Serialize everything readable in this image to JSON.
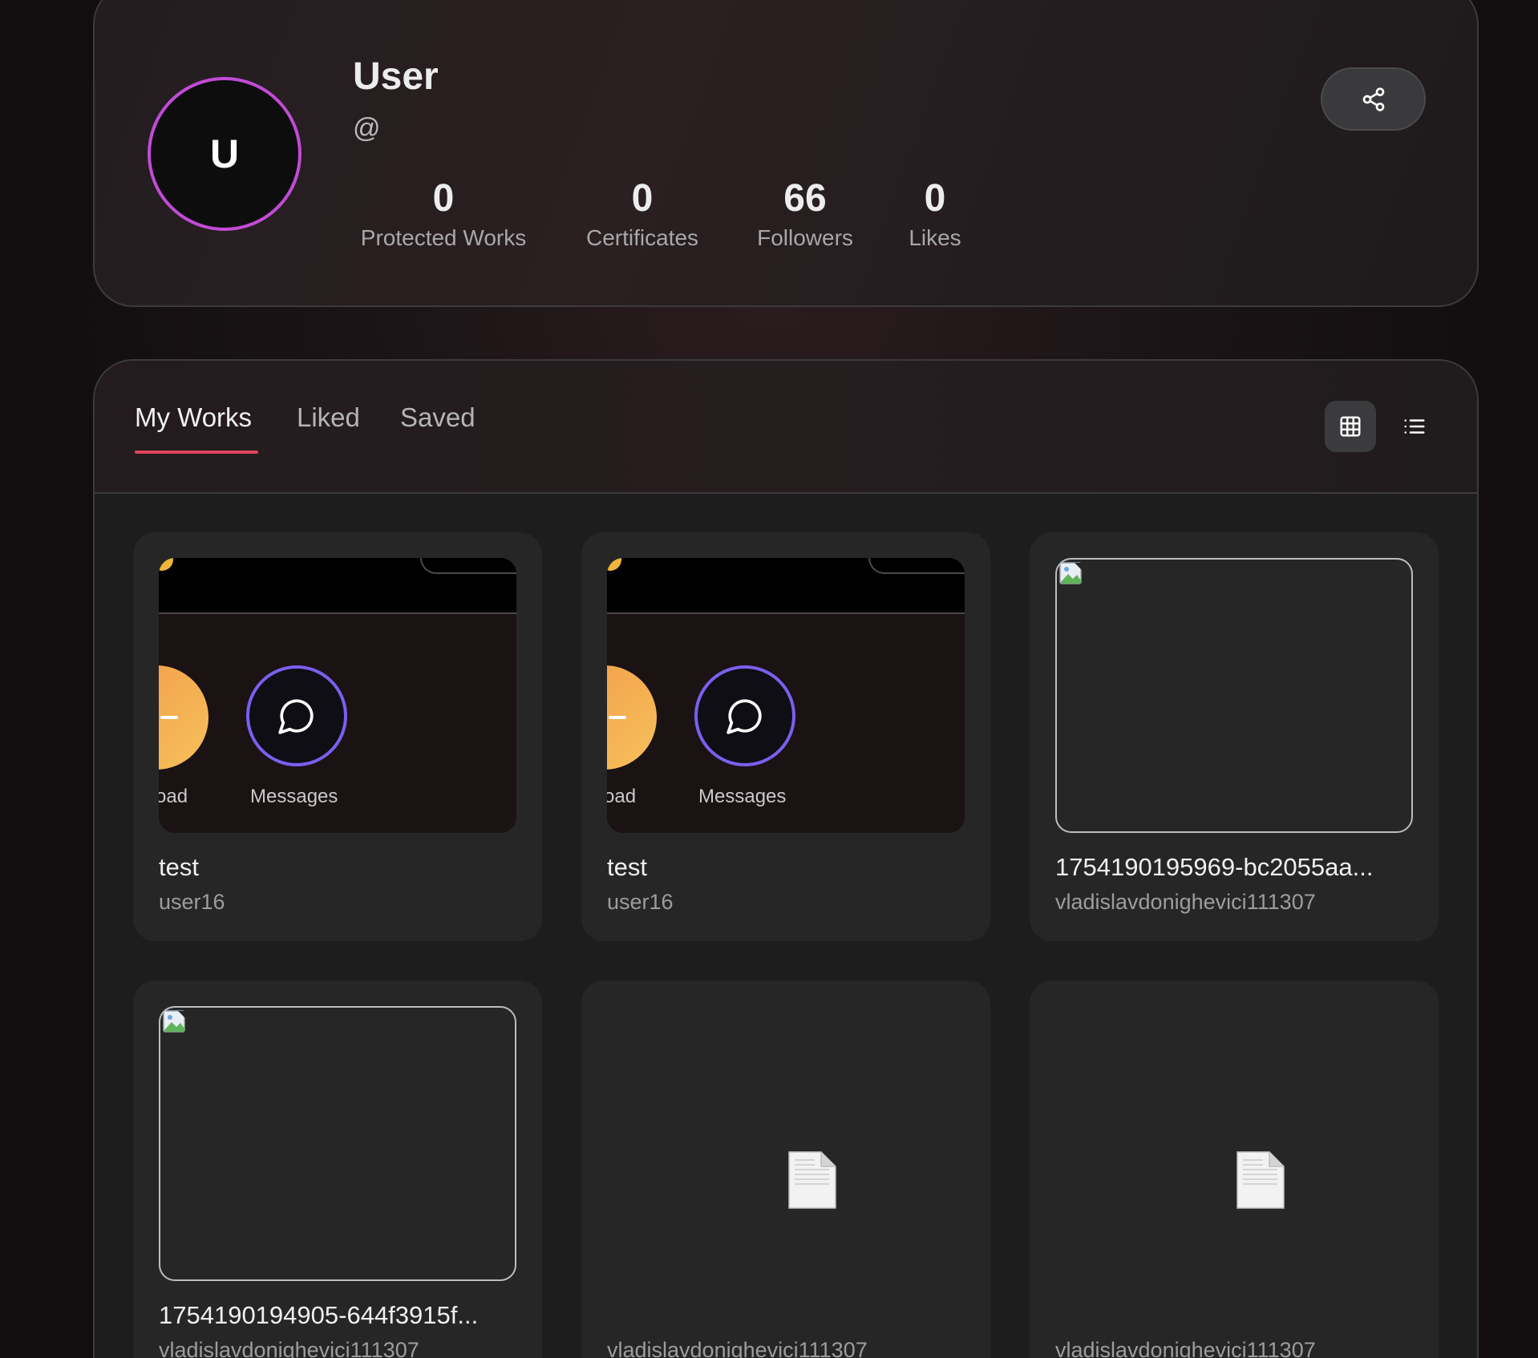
{
  "profile": {
    "avatar_initial": "U",
    "name": "User",
    "handle": "@",
    "stats": [
      {
        "value": "0",
        "label": "Protected Works"
      },
      {
        "value": "0",
        "label": "Certificates"
      },
      {
        "value": "66",
        "label": "Followers"
      },
      {
        "value": "0",
        "label": "Likes"
      }
    ],
    "share_icon": "share-icon"
  },
  "tabs": [
    {
      "label": "My Works",
      "active": true
    },
    {
      "label": "Liked",
      "active": false
    },
    {
      "label": "Saved",
      "active": false
    }
  ],
  "view_toggle": {
    "grid_icon": "grid-icon",
    "list_icon": "list-icon",
    "active": "grid"
  },
  "works": [
    {
      "title": "test",
      "author": "user16",
      "thumb": "screenshot",
      "thumb_labels": [
        "oad",
        "Messages"
      ]
    },
    {
      "title": "test",
      "author": "user16",
      "thumb": "screenshot",
      "thumb_labels": [
        "oad",
        "Messages"
      ]
    },
    {
      "title": "1754190195969-bc2055aa...",
      "author": "vladislavdonighevici111307",
      "thumb": "broken-image"
    },
    {
      "title": "1754190194905-644f3915f...",
      "author": "vladislavdonighevici111307",
      "thumb": "broken-image"
    },
    {
      "title": "",
      "author": "vladislavdonighevici111307",
      "thumb": "file"
    },
    {
      "title": "",
      "author": "vladislavdonighevici111307",
      "thumb": "file"
    }
  ],
  "colors": {
    "accent_tab_underline": "#e0455e",
    "avatar_ring": "#c24bd6",
    "messages_ring": "#7a5ff0"
  }
}
